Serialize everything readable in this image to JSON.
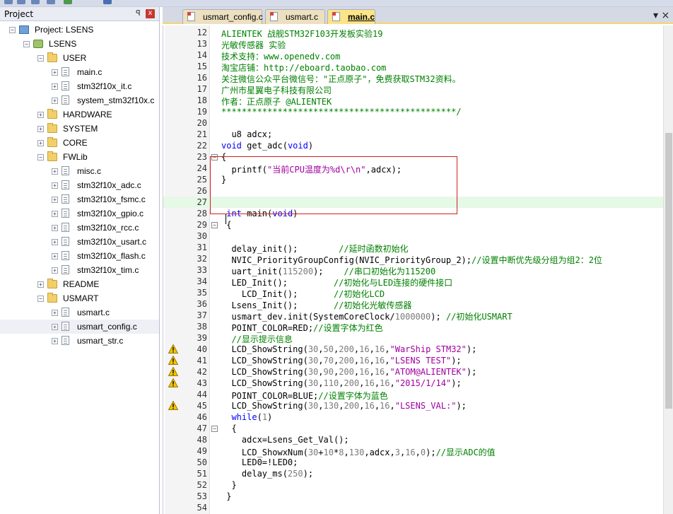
{
  "panel": {
    "title": "Project",
    "pin_glyph": "ꟼ",
    "close_glyph": "x"
  },
  "tree": [
    {
      "label": "Project: LSENS",
      "type": "project",
      "expander": "−",
      "icon": "project-icon"
    },
    {
      "label": "LSENS",
      "type": "target",
      "expander": "−",
      "icon": "target-icon"
    },
    {
      "label": "USER",
      "type": "folder",
      "expander": "−",
      "icon": "folder-icon"
    },
    {
      "label": "main.c",
      "type": "file",
      "expander": "+",
      "icon": "file-icon"
    },
    {
      "label": "stm32f10x_it.c",
      "type": "file",
      "expander": "+",
      "icon": "file-icon"
    },
    {
      "label": "system_stm32f10x.c",
      "type": "file",
      "expander": "+",
      "icon": "file-icon"
    },
    {
      "label": "HARDWARE",
      "type": "folder",
      "expander": "+",
      "icon": "folder-icon"
    },
    {
      "label": "SYSTEM",
      "type": "folder",
      "expander": "+",
      "icon": "folder-icon"
    },
    {
      "label": "CORE",
      "type": "folder",
      "expander": "+",
      "icon": "folder-icon"
    },
    {
      "label": "FWLib",
      "type": "folder",
      "expander": "−",
      "icon": "folder-icon"
    },
    {
      "label": "misc.c",
      "type": "file",
      "expander": "+",
      "icon": "file-icon"
    },
    {
      "label": "stm32f10x_adc.c",
      "type": "file",
      "expander": "+",
      "icon": "file-icon"
    },
    {
      "label": "stm32f10x_fsmc.c",
      "type": "file",
      "expander": "+",
      "icon": "file-icon"
    },
    {
      "label": "stm32f10x_gpio.c",
      "type": "file",
      "expander": "+",
      "icon": "file-icon"
    },
    {
      "label": "stm32f10x_rcc.c",
      "type": "file",
      "expander": "+",
      "icon": "file-icon"
    },
    {
      "label": "stm32f10x_usart.c",
      "type": "file",
      "expander": "+",
      "icon": "file-icon"
    },
    {
      "label": "stm32f10x_flash.c",
      "type": "file",
      "expander": "+",
      "icon": "file-icon"
    },
    {
      "label": "stm32f10x_tim.c",
      "type": "file",
      "expander": "+",
      "icon": "file-icon"
    },
    {
      "label": "README",
      "type": "folder",
      "expander": "+",
      "icon": "folder-icon"
    },
    {
      "label": "USMART",
      "type": "folder",
      "expander": "−",
      "icon": "folder-icon"
    },
    {
      "label": "usmart.c",
      "type": "file",
      "expander": "+",
      "icon": "file-icon"
    },
    {
      "label": "usmart_config.c",
      "type": "file",
      "expander": "+",
      "icon": "file-icon",
      "selected": true
    },
    {
      "label": "usmart_str.c",
      "type": "file",
      "expander": "+",
      "icon": "file-icon"
    }
  ],
  "tabs": [
    {
      "label": "usmart_config.c",
      "active": false
    },
    {
      "label": "usmart.c",
      "active": false
    },
    {
      "label": "main.c",
      "active": true
    }
  ],
  "editor_close_glyph": "▾ ×",
  "code": [
    {
      "n": "12",
      "segs": [
        [
          "c",
          "ALIENTEK 战舰STM32F103开发板实验19"
        ]
      ]
    },
    {
      "n": "13",
      "segs": [
        [
          "c",
          "光敏传感器 实验"
        ]
      ]
    },
    {
      "n": "14",
      "segs": [
        [
          "c",
          "技术支持：www.openedv.com"
        ]
      ]
    },
    {
      "n": "15",
      "segs": [
        [
          "c",
          "淘宝店铺：http://eboard.taobao.com"
        ]
      ]
    },
    {
      "n": "16",
      "segs": [
        [
          "c",
          "关注微信公众平台微信号：\"正点原子\"，免费获取STM32资料。"
        ]
      ]
    },
    {
      "n": "17",
      "segs": [
        [
          "c",
          "广州市星翼电子科技有限公司"
        ]
      ]
    },
    {
      "n": "18",
      "segs": [
        [
          "c",
          "作者：正点原子 @ALIENTEK"
        ]
      ]
    },
    {
      "n": "19",
      "segs": [
        [
          "c",
          "**********************************************/"
        ]
      ]
    },
    {
      "n": "20",
      "segs": []
    },
    {
      "n": "21",
      "segs": [
        [
          "p",
          "  u8 adcx;"
        ]
      ]
    },
    {
      "n": "22",
      "segs": [
        [
          "k",
          "void"
        ],
        [
          "p",
          " get_adc("
        ],
        [
          "k",
          "void"
        ],
        [
          "p",
          ")"
        ]
      ]
    },
    {
      "n": "23",
      "fold": "−",
      "segs": [
        [
          "p",
          "{"
        ]
      ]
    },
    {
      "n": "24",
      "segs": [
        [
          "p",
          "  printf("
        ],
        [
          "s",
          "\"当前CPU温度为%d\\r\\n\""
        ],
        [
          "p",
          ",adcx);"
        ]
      ]
    },
    {
      "n": "25",
      "segs": [
        [
          "p",
          "}"
        ]
      ]
    },
    {
      "n": "26",
      "segs": []
    },
    {
      "n": "27",
      "current": true,
      "segs": []
    },
    {
      "n": "28",
      "segs": [
        [
          "k",
          " int"
        ],
        [
          "p",
          " main("
        ],
        [
          "k",
          "void"
        ],
        [
          "p",
          ")"
        ]
      ]
    },
    {
      "n": "29",
      "fold": "−",
      "segs": [
        [
          "p",
          " {"
        ]
      ]
    },
    {
      "n": "30",
      "segs": []
    },
    {
      "n": "31",
      "segs": [
        [
          "p",
          "  delay_init();        "
        ],
        [
          "c",
          "//延时函数初始化"
        ]
      ]
    },
    {
      "n": "32",
      "segs": [
        [
          "p",
          "  NVIC_PriorityGroupConfig(NVIC_PriorityGroup_2);"
        ],
        [
          "c",
          "//设置中断优先级分组为组2：2位"
        ]
      ]
    },
    {
      "n": "33",
      "segs": [
        [
          "p",
          "  uart_init("
        ],
        [
          "n",
          "115200"
        ],
        [
          "p",
          ");    "
        ],
        [
          "c",
          "//串口初始化为115200"
        ]
      ]
    },
    {
      "n": "34",
      "segs": [
        [
          "p",
          "  LED_Init();         "
        ],
        [
          "c",
          "//初始化与LED连接的硬件接口"
        ]
      ]
    },
    {
      "n": "35",
      "segs": [
        [
          "p",
          "    LCD_Init();       "
        ],
        [
          "c",
          "//初始化LCD"
        ]
      ]
    },
    {
      "n": "36",
      "segs": [
        [
          "p",
          "  Lsens_Init();       "
        ],
        [
          "c",
          "//初始化光敏传感器"
        ]
      ]
    },
    {
      "n": "37",
      "segs": [
        [
          "p",
          "  usmart_dev.init(SystemCoreClock/"
        ],
        [
          "n",
          "1000000"
        ],
        [
          "p",
          "); "
        ],
        [
          "c",
          "//初始化USMART"
        ]
      ]
    },
    {
      "n": "38",
      "segs": [
        [
          "p",
          "  POINT_COLOR=RED;"
        ],
        [
          "c",
          "//设置字体为红色"
        ]
      ]
    },
    {
      "n": "39",
      "segs": [
        [
          "c",
          "  //显示提示信息"
        ]
      ]
    },
    {
      "n": "40",
      "warn": true,
      "segs": [
        [
          "p",
          "  LCD_ShowString("
        ],
        [
          "n",
          "30"
        ],
        [
          "p",
          ","
        ],
        [
          "n",
          "50"
        ],
        [
          "p",
          ","
        ],
        [
          "n",
          "200"
        ],
        [
          "p",
          ","
        ],
        [
          "n",
          "16"
        ],
        [
          "p",
          ","
        ],
        [
          "n",
          "16"
        ],
        [
          "p",
          ","
        ],
        [
          "s",
          "\"WarShip STM32\""
        ],
        [
          "p",
          ");"
        ]
      ]
    },
    {
      "n": "41",
      "warn": true,
      "segs": [
        [
          "p",
          "  LCD_ShowString("
        ],
        [
          "n",
          "30"
        ],
        [
          "p",
          ","
        ],
        [
          "n",
          "70"
        ],
        [
          "p",
          ","
        ],
        [
          "n",
          "200"
        ],
        [
          "p",
          ","
        ],
        [
          "n",
          "16"
        ],
        [
          "p",
          ","
        ],
        [
          "n",
          "16"
        ],
        [
          "p",
          ","
        ],
        [
          "s",
          "\"LSENS TEST\""
        ],
        [
          "p",
          ");"
        ]
      ]
    },
    {
      "n": "42",
      "warn": true,
      "segs": [
        [
          "p",
          "  LCD_ShowString("
        ],
        [
          "n",
          "30"
        ],
        [
          "p",
          ","
        ],
        [
          "n",
          "90"
        ],
        [
          "p",
          ","
        ],
        [
          "n",
          "200"
        ],
        [
          "p",
          ","
        ],
        [
          "n",
          "16"
        ],
        [
          "p",
          ","
        ],
        [
          "n",
          "16"
        ],
        [
          "p",
          ","
        ],
        [
          "s",
          "\"ATOM@ALIENTEK\""
        ],
        [
          "p",
          ");"
        ]
      ]
    },
    {
      "n": "43",
      "warn": true,
      "segs": [
        [
          "p",
          "  LCD_ShowString("
        ],
        [
          "n",
          "30"
        ],
        [
          "p",
          ","
        ],
        [
          "n",
          "110"
        ],
        [
          "p",
          ","
        ],
        [
          "n",
          "200"
        ],
        [
          "p",
          ","
        ],
        [
          "n",
          "16"
        ],
        [
          "p",
          ","
        ],
        [
          "n",
          "16"
        ],
        [
          "p",
          ","
        ],
        [
          "s",
          "\"2015/1/14\""
        ],
        [
          "p",
          ");"
        ]
      ]
    },
    {
      "n": "44",
      "segs": [
        [
          "p",
          "  POINT_COLOR=BLUE;"
        ],
        [
          "c",
          "//设置字体为蓝色"
        ]
      ]
    },
    {
      "n": "45",
      "warn": true,
      "segs": [
        [
          "p",
          "  LCD_ShowString("
        ],
        [
          "n",
          "30"
        ],
        [
          "p",
          ","
        ],
        [
          "n",
          "130"
        ],
        [
          "p",
          ","
        ],
        [
          "n",
          "200"
        ],
        [
          "p",
          ","
        ],
        [
          "n",
          "16"
        ],
        [
          "p",
          ","
        ],
        [
          "n",
          "16"
        ],
        [
          "p",
          ","
        ],
        [
          "s",
          "\"LSENS_VAL:\""
        ],
        [
          "p",
          ");"
        ]
      ]
    },
    {
      "n": "46",
      "segs": [
        [
          "k",
          "  while"
        ],
        [
          "p",
          "("
        ],
        [
          "n",
          "1"
        ],
        [
          "p",
          ")"
        ]
      ]
    },
    {
      "n": "47",
      "fold": "−",
      "segs": [
        [
          "p",
          "  {"
        ]
      ]
    },
    {
      "n": "48",
      "segs": [
        [
          "p",
          "    adcx=Lsens_Get_Val();"
        ]
      ]
    },
    {
      "n": "49",
      "segs": [
        [
          "p",
          "    LCD_ShowxNum("
        ],
        [
          "n",
          "30"
        ],
        [
          "p",
          "+"
        ],
        [
          "n",
          "10"
        ],
        [
          "p",
          "*"
        ],
        [
          "n",
          "8"
        ],
        [
          "p",
          ","
        ],
        [
          "n",
          "130"
        ],
        [
          "p",
          ",adcx,"
        ],
        [
          "n",
          "3"
        ],
        [
          "p",
          ","
        ],
        [
          "n",
          "16"
        ],
        [
          "p",
          ","
        ],
        [
          "n",
          "0"
        ],
        [
          "p",
          ");"
        ],
        [
          "c",
          "//显示ADC的值"
        ]
      ]
    },
    {
      "n": "50",
      "segs": [
        [
          "p",
          "    LED0=!LED0;"
        ]
      ]
    },
    {
      "n": "51",
      "segs": [
        [
          "p",
          "    delay_ms("
        ],
        [
          "n",
          "250"
        ],
        [
          "p",
          ");"
        ]
      ]
    },
    {
      "n": "52",
      "segs": [
        [
          "p",
          "  }"
        ]
      ]
    },
    {
      "n": "53",
      "segs": [
        [
          "p",
          " }"
        ]
      ]
    },
    {
      "n": "54",
      "segs": []
    }
  ],
  "colors": {
    "comment": "#008000",
    "keyword": "#0000ff",
    "number": "#7a7a7a",
    "string": "#a000a0",
    "highlight_box": "#d21f1f",
    "current_line": "#e6f8e6"
  }
}
